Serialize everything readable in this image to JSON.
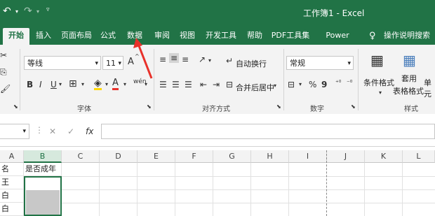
{
  "app": {
    "title": "工作簿1 - Excel",
    "undo_icon": "undo-icon",
    "redo_icon": "redo-icon",
    "customize_icon": "customize-qat-icon"
  },
  "tabs": [
    "开始",
    "插入",
    "页面布局",
    "公式",
    "数据",
    "审阅",
    "视图",
    "开发工具",
    "帮助",
    "PDF工具集",
    "Power Pivot"
  ],
  "active_tab": "开始",
  "tell_me": "操作说明搜索",
  "font_group": {
    "font_name": "等线",
    "font_size": "11",
    "grow_font": "A",
    "bold": "B",
    "italic": "I",
    "underline": "U",
    "font_color_glyph": "A",
    "phonetic": "wén",
    "label": "字体"
  },
  "alignment_group": {
    "wrap_text": "自动换行",
    "merge_center": "合并后居中",
    "label": "对齐方式"
  },
  "number_group": {
    "format": "常规",
    "percent": "%",
    "comma": "9",
    "label": "数字"
  },
  "styles_group": {
    "conditional": "条件格式",
    "table_format_1": "套用",
    "table_format_2": "表格格式",
    "cell_styles": "单元",
    "label": "样式"
  },
  "formula_bar": {
    "fx": "fx",
    "cancel": "✕",
    "confirm": "✓"
  },
  "columns": [
    "A",
    "B",
    "C",
    "D",
    "E",
    "F",
    "G",
    "H",
    "I",
    "J",
    "K",
    "L"
  ],
  "cells": {
    "a1": "名",
    "b1": "是否成年",
    "a2": "王",
    "a3": "白",
    "a4": "白"
  },
  "colors": {
    "brand": "#217346",
    "annotation_arrow": "#e8312a"
  }
}
